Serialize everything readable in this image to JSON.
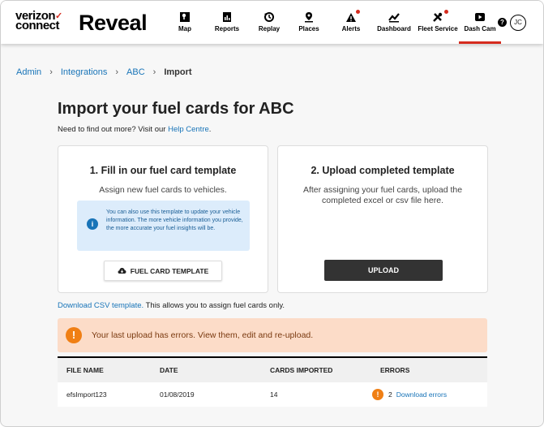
{
  "header": {
    "logo_top": "verizon",
    "logo_bottom": "connect",
    "logo_mark": "✓",
    "brand": "Reveal",
    "nav": [
      {
        "label": "Map",
        "icon": "map-icon"
      },
      {
        "label": "Reports",
        "icon": "reports-icon"
      },
      {
        "label": "Replay",
        "icon": "replay-icon"
      },
      {
        "label": "Places",
        "icon": "places-icon"
      },
      {
        "label": "Alerts",
        "icon": "alerts-icon"
      },
      {
        "label": "Dashboard",
        "icon": "dashboard-icon"
      },
      {
        "label": "Fleet Service",
        "icon": "fleet-service-icon"
      },
      {
        "label": "Dash Cam",
        "icon": "dash-cam-icon"
      }
    ],
    "help": "?",
    "avatar": "JC"
  },
  "breadcrumb": {
    "items": [
      "Admin",
      "Integrations",
      "ABC"
    ],
    "current": "Import"
  },
  "page": {
    "title": "Import your fuel cards for ABC",
    "subtitle_prefix": "Need to find out more? Visit our ",
    "subtitle_link": "Help Centre",
    "subtitle_suffix": "."
  },
  "card1": {
    "title": "1. Fill in our fuel card template",
    "desc": "Assign new fuel cards to vehicles.",
    "info": "You can also use this template to update your vehicle information. The more vehicle information you provide, the more accurate your fuel insights will be.",
    "button": "FUEL CARD TEMPLATE"
  },
  "card2": {
    "title": "2. Upload completed template",
    "desc": "After assigning your fuel cards, upload the completed excel or csv file here.",
    "button": "UPLOAD"
  },
  "csv": {
    "link": "Download CSV template.",
    "text": " This allows you to assign fuel cards only."
  },
  "error_banner": {
    "icon": "!",
    "text": "Your last upload has errors. View them, edit and re-upload."
  },
  "table": {
    "headers": [
      "FILE NAME",
      "DATE",
      "CARDS IMPORTED",
      "ERRORS"
    ],
    "rows": [
      {
        "file": "efsImport123",
        "date": "01/08/2019",
        "cards": "14",
        "errors": "2",
        "link": "Download errors"
      }
    ]
  },
  "colors": {
    "accent_red": "#d52b1e",
    "link_blue": "#1874b8",
    "warning_orange": "#f07f14",
    "banner_bg": "#fcdcc8",
    "info_bg": "#dcecfb"
  }
}
